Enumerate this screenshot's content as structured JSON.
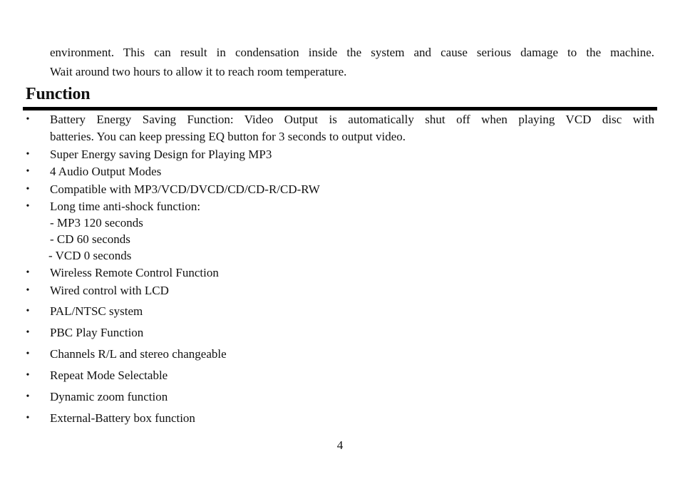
{
  "intro": {
    "line1": "environment. This can result in condensation inside the system and cause serious damage to the machine.",
    "line2": "Wait around two hours to allow it to reach room temperature."
  },
  "section": {
    "heading": "Function"
  },
  "bullet_glyph": "•",
  "features": [
    {
      "line1": "Battery Energy Saving Function: Video Output is automatically shut off when playing VCD disc with",
      "line2": "batteries. You can keep pressing EQ button for 3 seconds to output video."
    },
    {
      "text": "Super Energy saving Design for Playing MP3"
    },
    {
      "text": "4 Audio Output Modes"
    },
    {
      "text": "Compatible with MP3/VCD/DVCD/CD/CD-R/CD-RW"
    },
    {
      "text": "Long time anti-shock function:",
      "sub_items": [
        "- MP3 120 seconds",
        "- CD 60 seconds",
        "- VCD 0 seconds"
      ]
    },
    {
      "text": "Wireless Remote Control Function"
    },
    {
      "text": "Wired control with LCD"
    },
    {
      "text": "PAL/NTSC system"
    },
    {
      "text": "PBC Play Function"
    },
    {
      "text": "Channels R/L and stereo changeable"
    },
    {
      "text": "Repeat Mode Selectable"
    },
    {
      "text": "Dynamic zoom function"
    },
    {
      "text": "External-Battery box function"
    }
  ],
  "footer": {
    "page_number": "4"
  }
}
